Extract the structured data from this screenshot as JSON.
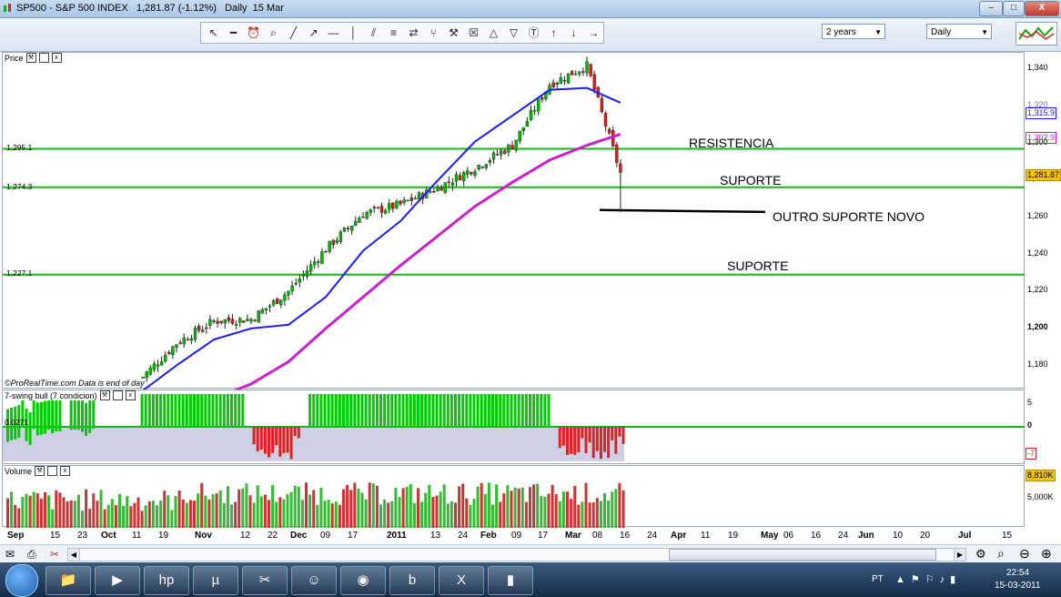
{
  "window": {
    "title": "SP500 - S&P 500 INDEX   1,281.87 (-1.12%)   Daily  15 Mar",
    "minimize": "–",
    "maximize": "□",
    "close": "X"
  },
  "toolbar": {
    "icons": [
      "cursor-icon",
      "ruler-icon",
      "alarm-icon",
      "zoom-icon",
      "line-icon",
      "ray-icon",
      "hline-icon",
      "vline-icon",
      "channel-icon",
      "fib-icon",
      "arrows-icon",
      "pitchfork-icon",
      "tools-icon",
      "trash-icon",
      "triangle-up-icon",
      "triangle-down-icon",
      "text-icon",
      "arrow-up-icon",
      "arrow-down-icon",
      "arrow-right-icon"
    ],
    "period": "2 years",
    "interval": "Daily"
  },
  "panels": {
    "price_title": "Price",
    "price_watermark": "©ProRealTime.com  Data is end of day",
    "swing_title": "7-swing bull (7 condicion)",
    "swing_value": "0.0271",
    "volume_title": "Volume"
  },
  "axes": {
    "price_ticks": [
      "1,340",
      "1,320",
      "1,300",
      "1,280",
      "1,260",
      "1,240",
      "1,220",
      "1,200",
      "1,180"
    ],
    "swing_ticks": [
      "5",
      "0",
      "-5"
    ],
    "volume_ticks": [
      "5,000K"
    ],
    "x_ticks": [
      "Sep",
      "15",
      "23",
      "Oct",
      "11",
      "19",
      "Nov",
      "12",
      "22",
      "Dec",
      "09",
      "17",
      "2011",
      "13",
      "24",
      "Feb",
      "09",
      "17",
      "Mar",
      "08",
      "16",
      "24",
      "Apr",
      "11",
      "19",
      "May",
      "06",
      "16",
      "24",
      "Jun",
      "10",
      "20",
      "Jul",
      "15"
    ]
  },
  "boxes": {
    "blue_ma": "1,315.9",
    "magenta_ma": "1,302.9",
    "last_price": "1,281.87",
    "swing_last": "-7",
    "volume_last": "8,810K"
  },
  "levels": {
    "l1": "1,295.1",
    "l2": "1,274.3",
    "l3": "1,227.1"
  },
  "annotations": {
    "resist": "RESISTENCIA",
    "sup1": "SUPORTE",
    "novo": "OUTRO SUPORTE NOVO",
    "sup2": "SUPORTE"
  },
  "taskbar": {
    "lang": "PT",
    "time": "22:54",
    "date": "15-03-2011"
  },
  "colors": {
    "support_line": "#19b619",
    "ma_fast": "#1a1aff",
    "ma_slow": "#cc1fcc",
    "up": "#00bb00",
    "down": "#cc2222"
  },
  "chart_data": {
    "type": "line",
    "title": "SP500 - S&P 500 INDEX",
    "ylim": [
      1165,
      1347
    ],
    "series": [
      {
        "x": [
          0,
          10,
          20,
          30,
          40,
          50,
          60,
          70,
          80,
          90,
          100,
          110,
          120,
          129
        ],
        "values": [
          1170,
          1190,
          1202,
          1203,
          1218,
          1241,
          1260,
          1265,
          1274,
          1285,
          1297,
          1330,
          1340,
          1282
        ]
      },
      {
        "x": [
          0,
          10,
          20,
          30,
          40,
          50,
          60,
          70,
          80,
          90,
          100,
          110,
          120,
          129
        ],
        "values": [
          1163,
          1178,
          1192,
          1198,
          1200,
          1215,
          1240,
          1256,
          1278,
          1299,
          1313,
          1327,
          1328,
          1320
        ]
      },
      {
        "x": [
          0,
          10,
          20,
          30,
          40,
          50,
          60,
          70,
          80,
          90,
          100,
          110,
          120,
          129
        ],
        "values": [
          1140,
          1150,
          1160,
          1168,
          1180,
          1198,
          1215,
          1232,
          1248,
          1264,
          1277,
          1289,
          1297,
          1303
        ]
      }
    ],
    "hlines": [
      1295.1,
      1274.3,
      1227.1
    ]
  }
}
